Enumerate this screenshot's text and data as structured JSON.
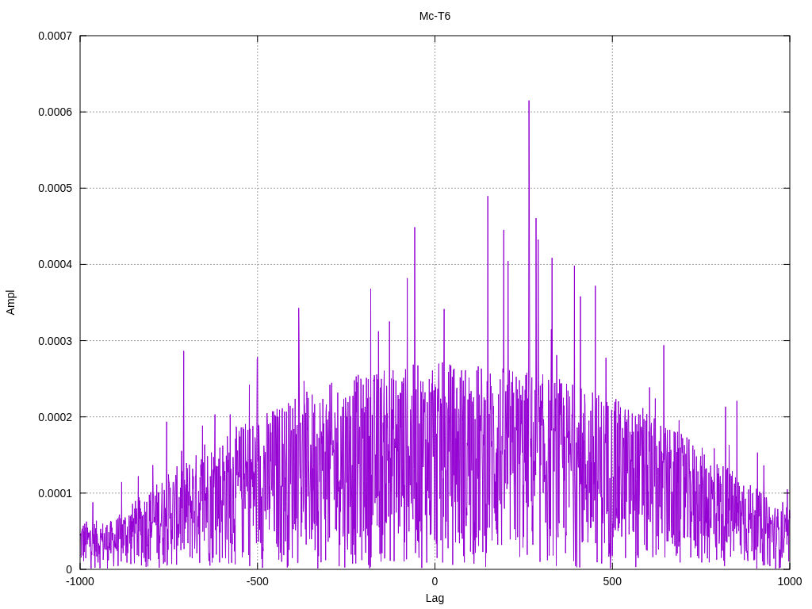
{
  "plot": {
    "title": "Mc-T6",
    "xlabel": "Lag",
    "ylabel": "Ampl",
    "xticks": [
      "-1000",
      "-500",
      "0",
      "500",
      "1000"
    ],
    "yticks": [
      "0.0007",
      "0.0006",
      "0.0005",
      "0.0004",
      "0.0003",
      "0.0002",
      "0.0001",
      "0"
    ]
  }
}
